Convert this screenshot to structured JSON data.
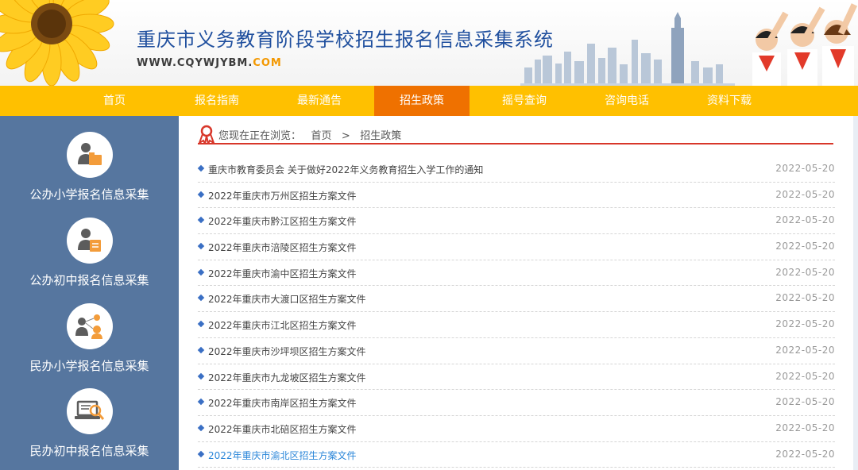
{
  "header": {
    "title": "重庆市义务教育阶段学校招生报名信息采集系统",
    "url_main": "WWW.CQYWJYBM.",
    "url_suffix": "COM"
  },
  "nav": {
    "items": [
      {
        "label": "首页"
      },
      {
        "label": "报名指南"
      },
      {
        "label": "最新通告"
      },
      {
        "label": "招生政策",
        "active": true
      },
      {
        "label": "摇号查询"
      },
      {
        "label": "咨询电话"
      },
      {
        "label": "资料下载"
      }
    ]
  },
  "sidebar": {
    "items": [
      {
        "label": "公办小学报名信息采集",
        "icon": "person-folder-icon"
      },
      {
        "label": "公办初中报名信息采集",
        "icon": "person-edit-icon"
      },
      {
        "label": "民办小学报名信息采集",
        "icon": "people-network-icon"
      },
      {
        "label": "民办初中报名信息采集",
        "icon": "laptop-search-icon"
      }
    ]
  },
  "breadcrumb": {
    "prefix": "您现在正在浏览：",
    "home": "首页",
    "separator": ">",
    "current": "招生政策"
  },
  "list": {
    "items": [
      {
        "title": "重庆市教育委员会 关于做好2022年义务教育招生入学工作的通知",
        "date": "2022-05-20"
      },
      {
        "title": "2022年重庆市万州区招生方案文件",
        "date": "2022-05-20"
      },
      {
        "title": "2022年重庆市黔江区招生方案文件",
        "date": "2022-05-20"
      },
      {
        "title": "2022年重庆市涪陵区招生方案文件",
        "date": "2022-05-20"
      },
      {
        "title": "2022年重庆市渝中区招生方案文件",
        "date": "2022-05-20"
      },
      {
        "title": "2022年重庆市大渡口区招生方案文件",
        "date": "2022-05-20"
      },
      {
        "title": "2022年重庆市江北区招生方案文件",
        "date": "2022-05-20"
      },
      {
        "title": "2022年重庆市沙坪坝区招生方案文件",
        "date": "2022-05-20"
      },
      {
        "title": "2022年重庆市九龙坡区招生方案文件",
        "date": "2022-05-20"
      },
      {
        "title": "2022年重庆市南岸区招生方案文件",
        "date": "2022-05-20"
      },
      {
        "title": "2022年重庆市北碚区招生方案文件",
        "date": "2022-05-20"
      },
      {
        "title": "2022年重庆市渝北区招生方案文件",
        "date": "2022-05-20",
        "hover": true
      }
    ]
  },
  "colors": {
    "nav_bg": "#ffc000",
    "nav_active": "#ef7100",
    "sidebar_bg": "#56769f",
    "title_blue": "#1f4f9e",
    "link_hover": "#2a86d9",
    "divider_red": "#d8372a"
  }
}
